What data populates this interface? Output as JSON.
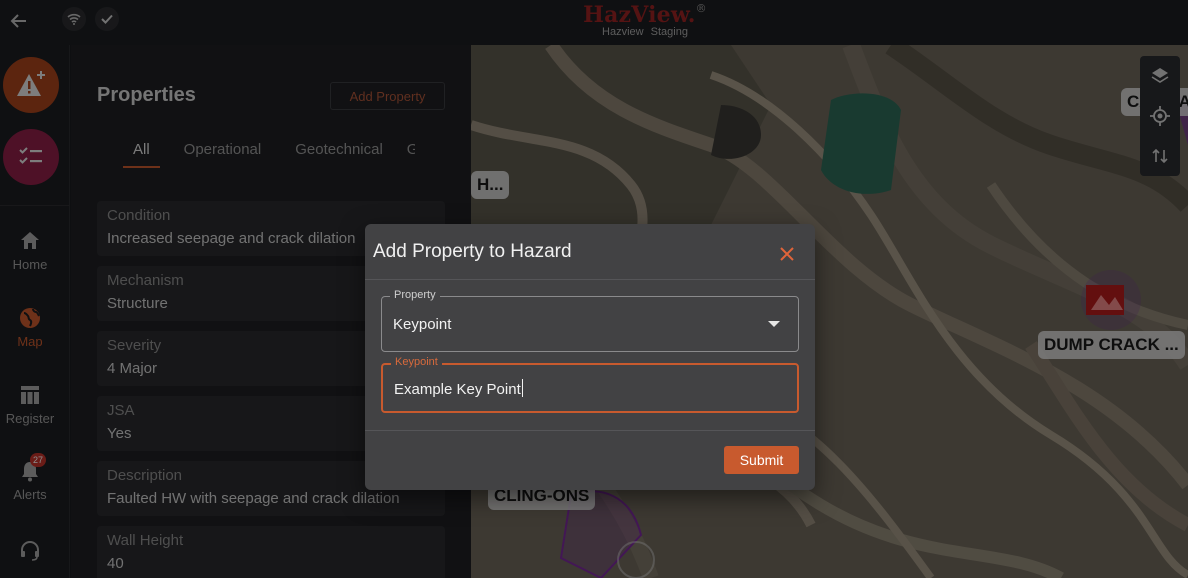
{
  "header": {
    "brand_title": "HazView.",
    "brand_mark": "®",
    "brand_subtitle": "Hazview Staging",
    "back_icon": "arrow-left-icon",
    "status_icons": [
      "wifi-icon",
      "check-icon"
    ]
  },
  "rail": {
    "items": [
      {
        "label": "Home",
        "icon": "home-icon"
      },
      {
        "label": "Map",
        "icon": "globe-icon",
        "active": true
      },
      {
        "label": "Register",
        "icon": "table-icon"
      },
      {
        "label": "Alerts",
        "icon": "bell-icon",
        "badge": "27"
      }
    ]
  },
  "panel": {
    "title": "Properties",
    "add_button": "Add Property",
    "tabs": [
      "All",
      "Operational",
      "Geotechnical",
      "G"
    ],
    "properties": [
      {
        "label": "Condition",
        "value": "Increased seepage and crack dilation"
      },
      {
        "label": "Mechanism",
        "value": "Structure"
      },
      {
        "label": "Severity",
        "value": "4 Major"
      },
      {
        "label": "JSA",
        "value": "Yes"
      },
      {
        "label": "Description",
        "value": "Faulted HW with seepage and crack dilation"
      },
      {
        "label": "Wall Height",
        "value": "40"
      }
    ]
  },
  "map": {
    "labels": [
      "H...",
      "CAR PA",
      "DUMP CRACK ...",
      "CLING-ONS"
    ]
  },
  "dialog": {
    "title": "Add Property to Hazard",
    "property_legend": "Property",
    "property_value": "Keypoint",
    "keypoint_legend": "Keypoint",
    "keypoint_value": "Example Key Point",
    "submit_label": "Submit"
  },
  "colors": {
    "accent": "#c85a2e",
    "brand": "#9c2424",
    "dialog_bg": "#424244",
    "panel_bg": "#1f2023"
  }
}
